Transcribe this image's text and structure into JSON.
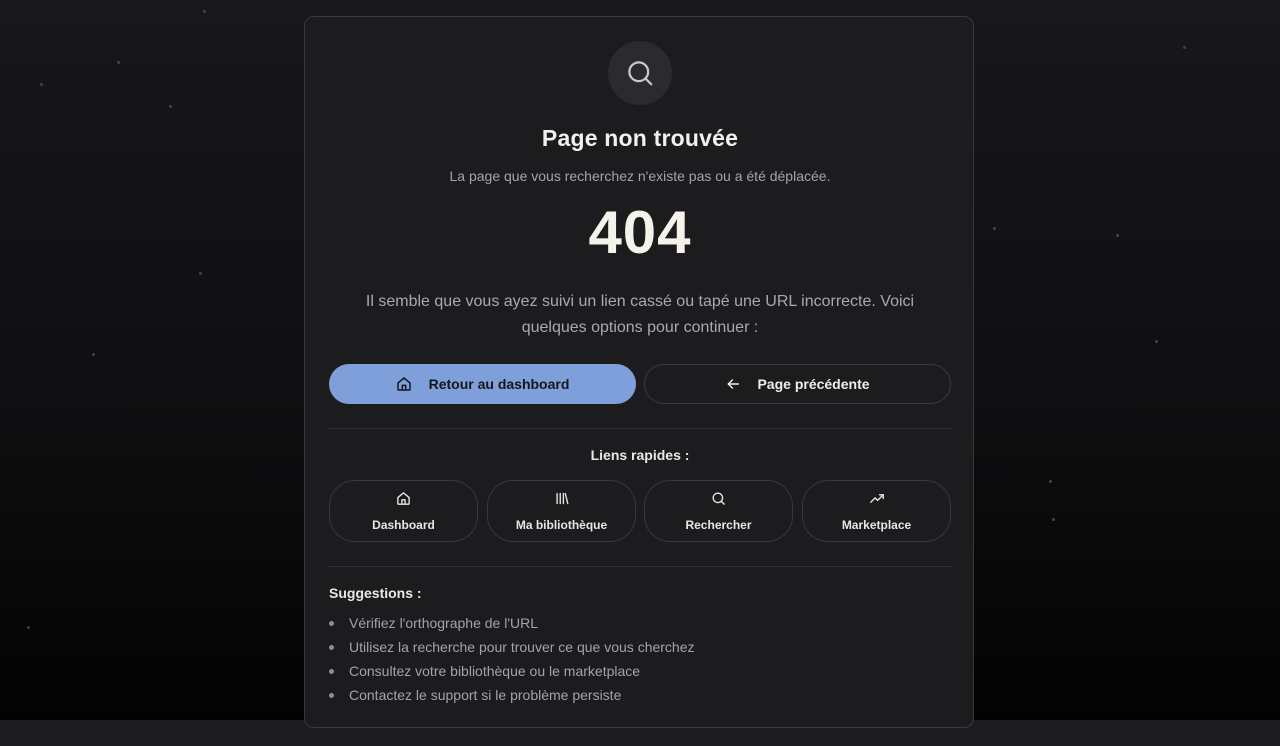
{
  "page": {
    "icon": "search-icon",
    "title": "Page non trouvée",
    "subtitle": "La page que vous recherchez n'existe pas ou a été déplacée.",
    "error_code": "404",
    "message": "Il semble que vous ayez suivi un lien cassé ou tapé une URL incorrecte. Voici quelques options pour continuer :"
  },
  "actions": {
    "primary": {
      "label": "Retour au dashboard",
      "icon": "home-icon"
    },
    "secondary": {
      "label": "Page précédente",
      "icon": "arrow-left-icon"
    }
  },
  "quick_links": {
    "title": "Liens rapides :",
    "items": [
      {
        "label": "Dashboard",
        "icon": "home-icon"
      },
      {
        "label": "Ma bibliothèque",
        "icon": "library-icon"
      },
      {
        "label": "Rechercher",
        "icon": "search-icon"
      },
      {
        "label": "Marketplace",
        "icon": "trending-up-icon"
      }
    ]
  },
  "suggestions": {
    "title": "Suggestions :",
    "items": [
      "Vérifiez l'orthographe de l'URL",
      "Utilisez la recherche pour trouver ce que vous cherchez",
      "Consultez votre bibliothèque ou le marketplace",
      "Contactez le support si le problème persiste"
    ]
  },
  "colors": {
    "primary_button": "#7e9fda",
    "card_background": "#1c1c1f",
    "page_background": "#0f0f11"
  }
}
